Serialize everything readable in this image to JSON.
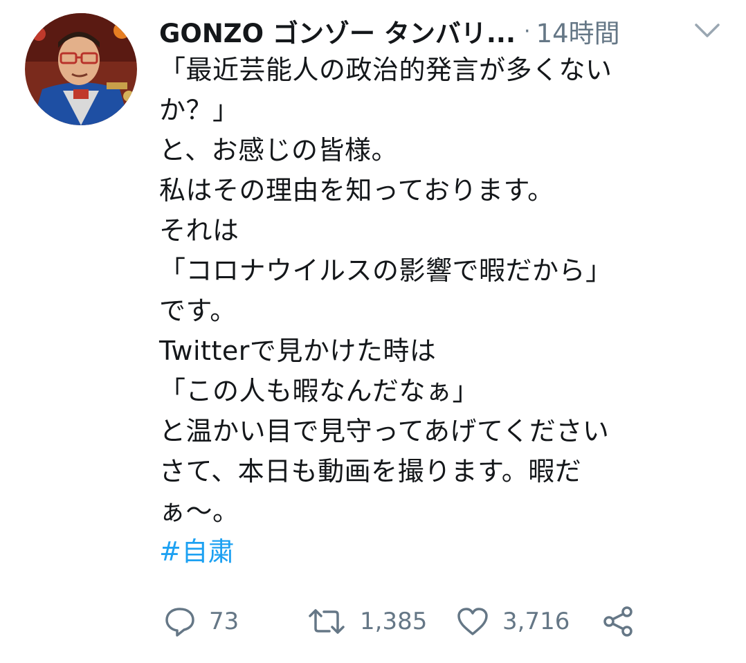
{
  "tweet": {
    "author_name": "GONZO ゴンゾー タンバリ...",
    "separator": "·",
    "time": "14時間",
    "lines": [
      "「最近芸能人の政治的発言が多くない",
      "か？」",
      "と、お感じの皆様。",
      "私はその理由を知っております。",
      "それは",
      "「コロナウイルスの影響で暇だから」",
      "です。",
      "Twitterで見かけた時は",
      "「この人も暇なんだなぁ」",
      "と温かい目で見守ってあげてください",
      "さて、本日も動画を撮ります。暇だ",
      "ぁ〜。"
    ],
    "hashtag": "#自粛"
  },
  "actions": {
    "reply_count": "73",
    "retweet_count": "1,385",
    "like_count": "3,716"
  },
  "colors": {
    "text": "#14171a",
    "secondary": "#657786",
    "link": "#1da1f2"
  },
  "icons": [
    "avatar",
    "chevron-down-icon",
    "reply-icon",
    "retweet-icon",
    "like-icon",
    "share-icon"
  ]
}
